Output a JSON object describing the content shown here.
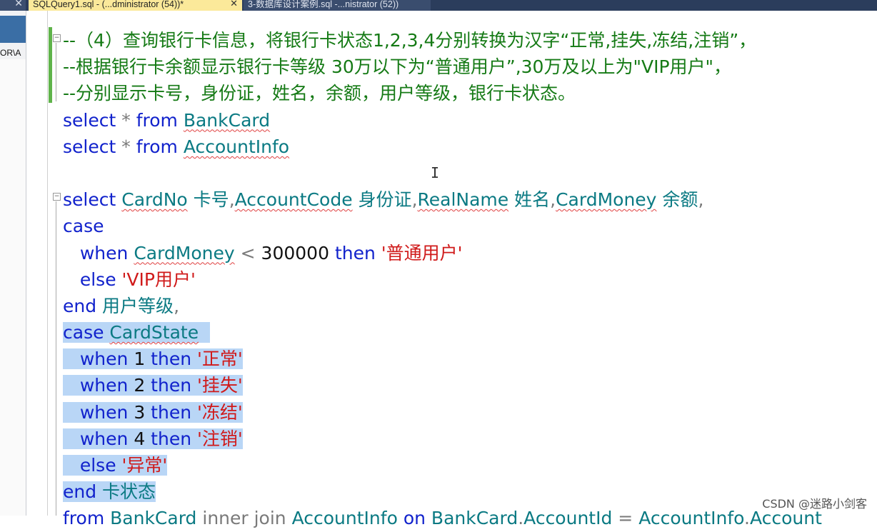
{
  "tabs": {
    "active_title": "SQLQuery1.sql - (...dministrator (54))*",
    "active_close": "✕",
    "inactive_title": "3-数据库设计案例.sql -...nistrator (52))",
    "left_close": "✕"
  },
  "side_panel": {
    "path_text": "OR\\A"
  },
  "code_lines": [
    {
      "hl": false,
      "tokens": [
        {
          "c": "cm",
          "t": "--（4）查询银行卡信息，将银行卡状态1,2,3,4分别转换为汉字“正常,挂失,冻结,注销”，"
        }
      ]
    },
    {
      "hl": false,
      "tokens": [
        {
          "c": "cm",
          "t": "--根据银行卡余额显示银行卡等级 30万以下为“普通用户”,30万及以上为\"VIP用户\"，"
        }
      ]
    },
    {
      "hl": false,
      "tokens": [
        {
          "c": "cm",
          "t": "--分别显示卡号，身份证，姓名，余额，用户等级，银行卡状态。"
        }
      ]
    },
    {
      "hl": false,
      "tokens": [
        {
          "c": "kw",
          "t": "select "
        },
        {
          "c": "op",
          "t": "* "
        },
        {
          "c": "kw",
          "t": "from "
        },
        {
          "c": "id",
          "t": "BankCard",
          "sq": true
        }
      ]
    },
    {
      "hl": false,
      "tokens": [
        {
          "c": "kw",
          "t": "select "
        },
        {
          "c": "op",
          "t": "* "
        },
        {
          "c": "kw",
          "t": "from "
        },
        {
          "c": "id",
          "t": "AccountInfo",
          "sq": true
        }
      ]
    },
    {
      "hl": false,
      "tokens": [
        {
          "c": "pl",
          "t": " "
        }
      ]
    },
    {
      "hl": false,
      "tokens": [
        {
          "c": "kw",
          "t": "select "
        },
        {
          "c": "id",
          "t": "CardNo",
          "sq": true
        },
        {
          "c": "pl",
          "t": " "
        },
        {
          "c": "id",
          "t": "卡号"
        },
        {
          "c": "op",
          "t": ","
        },
        {
          "c": "id",
          "t": "AccountCode",
          "sq": true
        },
        {
          "c": "pl",
          "t": " "
        },
        {
          "c": "id",
          "t": "身份证"
        },
        {
          "c": "op",
          "t": ","
        },
        {
          "c": "id",
          "t": "RealName",
          "sq": true
        },
        {
          "c": "pl",
          "t": " "
        },
        {
          "c": "id",
          "t": "姓名"
        },
        {
          "c": "op",
          "t": ","
        },
        {
          "c": "id",
          "t": "CardMoney",
          "sq": true
        },
        {
          "c": "pl",
          "t": " "
        },
        {
          "c": "id",
          "t": "余额"
        },
        {
          "c": "op",
          "t": ","
        }
      ]
    },
    {
      "hl": false,
      "tokens": [
        {
          "c": "kw",
          "t": "case"
        }
      ]
    },
    {
      "hl": false,
      "tokens": [
        {
          "c": "pl",
          "t": "   "
        },
        {
          "c": "kw",
          "t": "when "
        },
        {
          "c": "id",
          "t": "CardMoney",
          "sq": true
        },
        {
          "c": "pl",
          "t": " "
        },
        {
          "c": "op",
          "t": "< "
        },
        {
          "c": "num",
          "t": "300000 "
        },
        {
          "c": "kw",
          "t": "then "
        },
        {
          "c": "str",
          "t": "'普通用户'"
        }
      ]
    },
    {
      "hl": false,
      "tokens": [
        {
          "c": "pl",
          "t": "   "
        },
        {
          "c": "kw",
          "t": "else "
        },
        {
          "c": "str",
          "t": "'VIP用户'"
        }
      ]
    },
    {
      "hl": false,
      "tokens": [
        {
          "c": "kw",
          "t": "end "
        },
        {
          "c": "id",
          "t": "用户等级"
        },
        {
          "c": "op",
          "t": ","
        }
      ]
    },
    {
      "hl": true,
      "tokens": [
        {
          "c": "kw",
          "t": "case "
        },
        {
          "c": "id",
          "t": "CardState",
          "sq": true
        },
        {
          "c": "pl",
          "t": "  "
        }
      ]
    },
    {
      "hl": true,
      "tokens": [
        {
          "c": "pl",
          "t": "   "
        },
        {
          "c": "kw",
          "t": "when "
        },
        {
          "c": "num",
          "t": "1 "
        },
        {
          "c": "kw",
          "t": "then "
        },
        {
          "c": "str",
          "t": "'正常'"
        }
      ]
    },
    {
      "hl": true,
      "tokens": [
        {
          "c": "pl",
          "t": "   "
        },
        {
          "c": "kw",
          "t": "when "
        },
        {
          "c": "num",
          "t": "2 "
        },
        {
          "c": "kw",
          "t": "then "
        },
        {
          "c": "str",
          "t": "'挂失'"
        }
      ]
    },
    {
      "hl": true,
      "tokens": [
        {
          "c": "pl",
          "t": "   "
        },
        {
          "c": "kw",
          "t": "when "
        },
        {
          "c": "num",
          "t": "3 "
        },
        {
          "c": "kw",
          "t": "then "
        },
        {
          "c": "str",
          "t": "'冻结'"
        }
      ]
    },
    {
      "hl": true,
      "tokens": [
        {
          "c": "pl",
          "t": "   "
        },
        {
          "c": "kw",
          "t": "when "
        },
        {
          "c": "num",
          "t": "4 "
        },
        {
          "c": "kw",
          "t": "then "
        },
        {
          "c": "str",
          "t": "'注销'"
        }
      ]
    },
    {
      "hl": true,
      "tokens": [
        {
          "c": "pl",
          "t": "   "
        },
        {
          "c": "kw",
          "t": "else "
        },
        {
          "c": "str",
          "t": "'异常'"
        }
      ]
    },
    {
      "hl": true,
      "tokens": [
        {
          "c": "kw",
          "t": "end "
        },
        {
          "c": "id",
          "t": "卡状态"
        }
      ]
    },
    {
      "hl": false,
      "tokens": [
        {
          "c": "kw",
          "t": "from "
        },
        {
          "c": "id",
          "t": "BankCard"
        },
        {
          "c": "pl",
          "t": " "
        },
        {
          "c": "op",
          "t": "inner join "
        },
        {
          "c": "id",
          "t": "AccountInfo"
        },
        {
          "c": "pl",
          "t": " "
        },
        {
          "c": "kw",
          "t": "on "
        },
        {
          "c": "id",
          "t": "BankCard"
        },
        {
          "c": "op",
          "t": "."
        },
        {
          "c": "id",
          "t": "AccountId"
        },
        {
          "c": "pl",
          "t": " "
        },
        {
          "c": "op",
          "t": "= "
        },
        {
          "c": "id",
          "t": "AccountInfo"
        },
        {
          "c": "op",
          "t": "."
        },
        {
          "c": "id",
          "t": "Account"
        }
      ]
    }
  ],
  "watermark": "CSDN @迷路小剑客",
  "colors": {
    "keyword": "#1122cc",
    "comment": "#157a15",
    "string": "#d01a1a",
    "identifier": "#0b7a83",
    "selection": "#b9d6f6",
    "active_tab": "#fbe99a"
  }
}
